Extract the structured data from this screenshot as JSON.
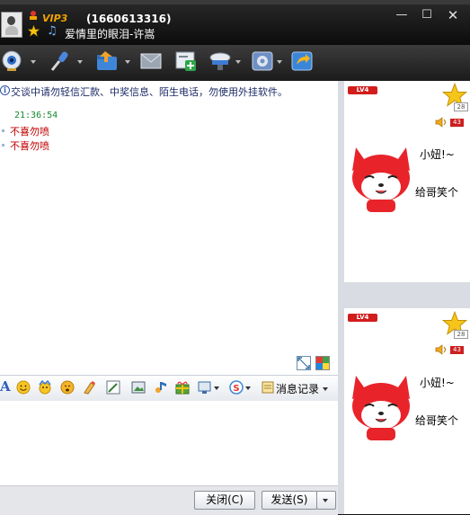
{
  "window": {
    "top_tabs": [
      "",
      "",
      "",
      "",
      "",
      ""
    ],
    "vip_label": "VIP3",
    "qq_number": "(1660613316)",
    "signature": "爱情里的眼泪-许嵩",
    "min_glyph": "—",
    "max_glyph": "☐",
    "close_glyph": "✕"
  },
  "toolbar": {
    "icons": [
      "video-call-icon",
      "voice-call-icon",
      "send-file-icon",
      "send-sms-icon",
      "add-app-icon",
      "remote-assist-icon",
      "settings-icon",
      "share-icon"
    ]
  },
  "chat": {
    "notice_glyph": "i",
    "notice": "交谈中请勿轻信汇款、中奖信息、陌生电话，勿使用外挂软件。",
    "time": "21:36:54",
    "messages": [
      "不喜勿喷",
      "不喜勿喷"
    ]
  },
  "format_bar": {
    "font_glyph": "A",
    "history_label": "消息记录"
  },
  "buttons": {
    "close": "关闭(C)",
    "send": "发送(S)"
  },
  "profile_cards": [
    {
      "level": "LV4",
      "star_count": "28",
      "sound_count": "43",
      "line1": "小妞!~",
      "line2": "给哥笑个"
    },
    {
      "level": "LV4",
      "star_count": "28",
      "sound_count": "43",
      "line1": "小妞!~",
      "line2": "给哥笑个"
    }
  ],
  "colors": {
    "titlebar": "#141414",
    "message_red": "#c00000",
    "time_green": "#138a2f",
    "notice_blue": "#1b2a66"
  }
}
